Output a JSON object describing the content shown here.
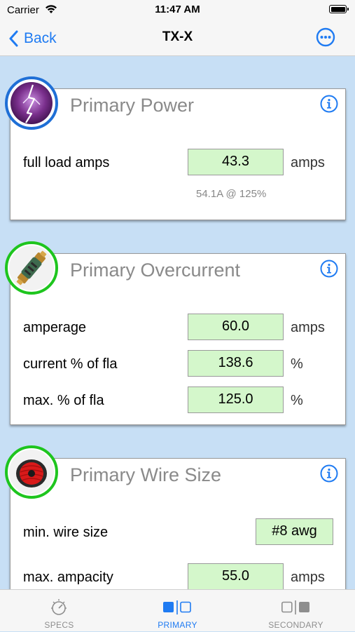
{
  "status_bar": {
    "carrier": "Carrier",
    "time": "11:47 AM"
  },
  "nav": {
    "back_label": "Back",
    "title": "TX-X"
  },
  "colors": {
    "accent": "#1f7bf2",
    "value_bg": "#d4f7cb",
    "page_bg": "#c7dff5",
    "ring_blue": "#1f6fd6",
    "ring_green": "#1ec51e"
  },
  "cards": {
    "power": {
      "title": "Primary Power",
      "icon": "lightning-icon",
      "rows": [
        {
          "label": "full load amps",
          "value": "43.3",
          "unit": "amps"
        }
      ],
      "note": "54.1A @ 125%"
    },
    "overcurrent": {
      "title": "Primary Overcurrent",
      "icon": "fuse-icon",
      "rows": [
        {
          "label": "amperage",
          "value": "60.0",
          "unit": "amps"
        },
        {
          "label": "current % of fla",
          "value": "138.6",
          "unit": "%"
        },
        {
          "label": "max. % of fla",
          "value": "125.0",
          "unit": "%"
        }
      ]
    },
    "wire": {
      "title": "Primary Wire Size",
      "icon": "wire-spool-icon",
      "rows": [
        {
          "label": "min. wire size",
          "value": "#8 awg",
          "unit": ""
        },
        {
          "label": "max. ampacity",
          "value": "55.0",
          "unit": "amps"
        }
      ]
    }
  },
  "tabs": [
    {
      "label": "SPECS",
      "icon": "gauge-icon",
      "active": false
    },
    {
      "label": "PRIMARY",
      "icon": "primary-panel-icon",
      "active": true
    },
    {
      "label": "SECONDARY",
      "icon": "secondary-panel-icon",
      "active": false
    }
  ]
}
